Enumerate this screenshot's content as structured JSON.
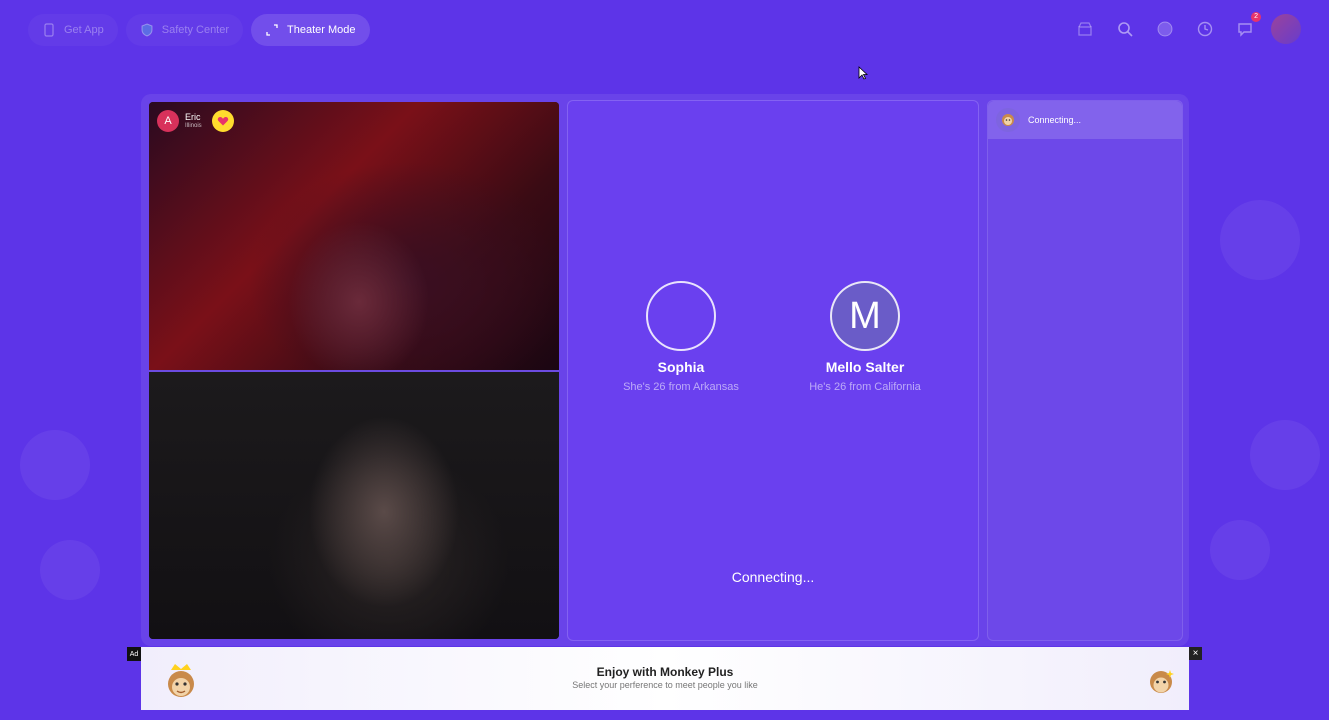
{
  "topbar": {
    "get_app": "Get App",
    "safety_center": "Safety Center",
    "theater_mode": "Theater Mode",
    "notification_badge": "2"
  },
  "video": {
    "user_initial": "A",
    "user_name": "Eric",
    "user_location": "Illinois"
  },
  "match": {
    "left": {
      "name": "Sophia",
      "desc": "She's 26 from Arkansas"
    },
    "right": {
      "initial": "M",
      "name": "Mello Salter",
      "desc": "He's 26 from California"
    },
    "status": "Connecting..."
  },
  "sidebar": {
    "row_text": "Connecting..."
  },
  "ad": {
    "label": "Ad",
    "title": "Enjoy with Monkey Plus",
    "subtitle": "Select your perference to meet people you like",
    "close": "×"
  },
  "colors": {
    "background": "#5d34e8",
    "accent_pink": "#d8315b",
    "heart_yellow": "#ffdc2e"
  }
}
